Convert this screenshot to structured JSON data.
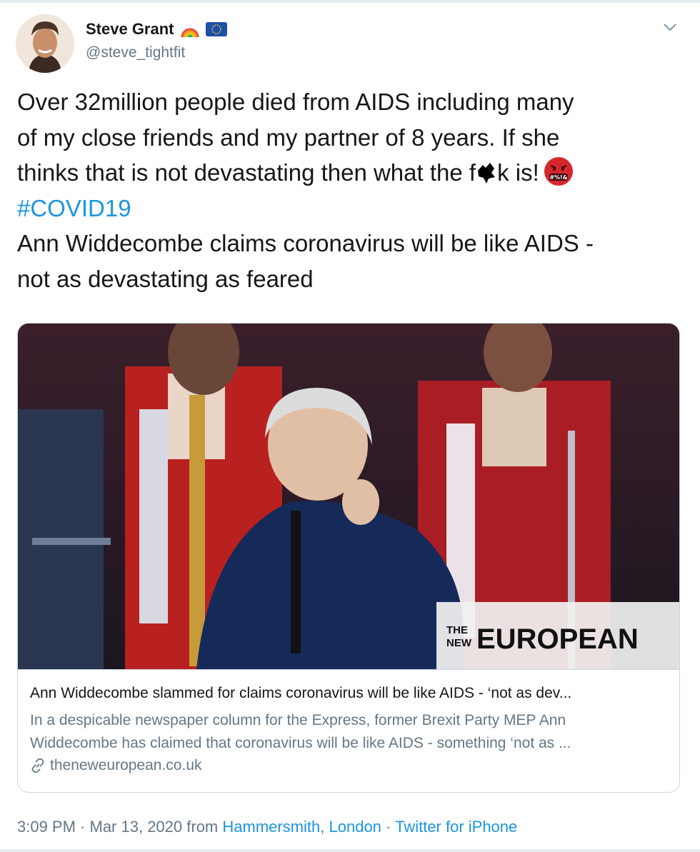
{
  "user": {
    "display_name": "Steve Grant",
    "handle": "@steve_tightfit",
    "badges": [
      "rainbow-icon",
      "eu-flag-icon"
    ]
  },
  "tweet": {
    "lines": [
      "Over 32million people died from AIDS including many",
      "of my close friends and my partner of 8 years. If she",
      "thinks that is not devastating then what the f",
      "k is!",
      "#COVID19",
      "Ann Widdecombe claims coronavirus will be like AIDS -",
      "not as devastating as feared"
    ],
    "emoji": "face-with-symbols-on-mouth-icon"
  },
  "card": {
    "image_watermark_small": "THE\nNEW",
    "image_watermark_big": "EUROPEAN",
    "title": "Ann Widdecombe slammed for claims coronavirus will be like AIDS - ‘not as dev...",
    "desc_line1": "In a despicable newspaper column for the Express, former Brexit Party MEP Ann",
    "desc_line2": "Widdecombe has claimed that coronavirus will be like AIDS - something ‘not as ...",
    "domain": "theneweuropean.co.uk"
  },
  "meta": {
    "time": "3:09 PM",
    "separator": " · ",
    "date": "Mar 13, 2020",
    "from": " from ",
    "location": "Hammersmith, London",
    "source": "Twitter for iPhone"
  },
  "colors": {
    "link": "#1b95e0",
    "secondary_text": "#657786",
    "border": "#ccd6dd"
  }
}
